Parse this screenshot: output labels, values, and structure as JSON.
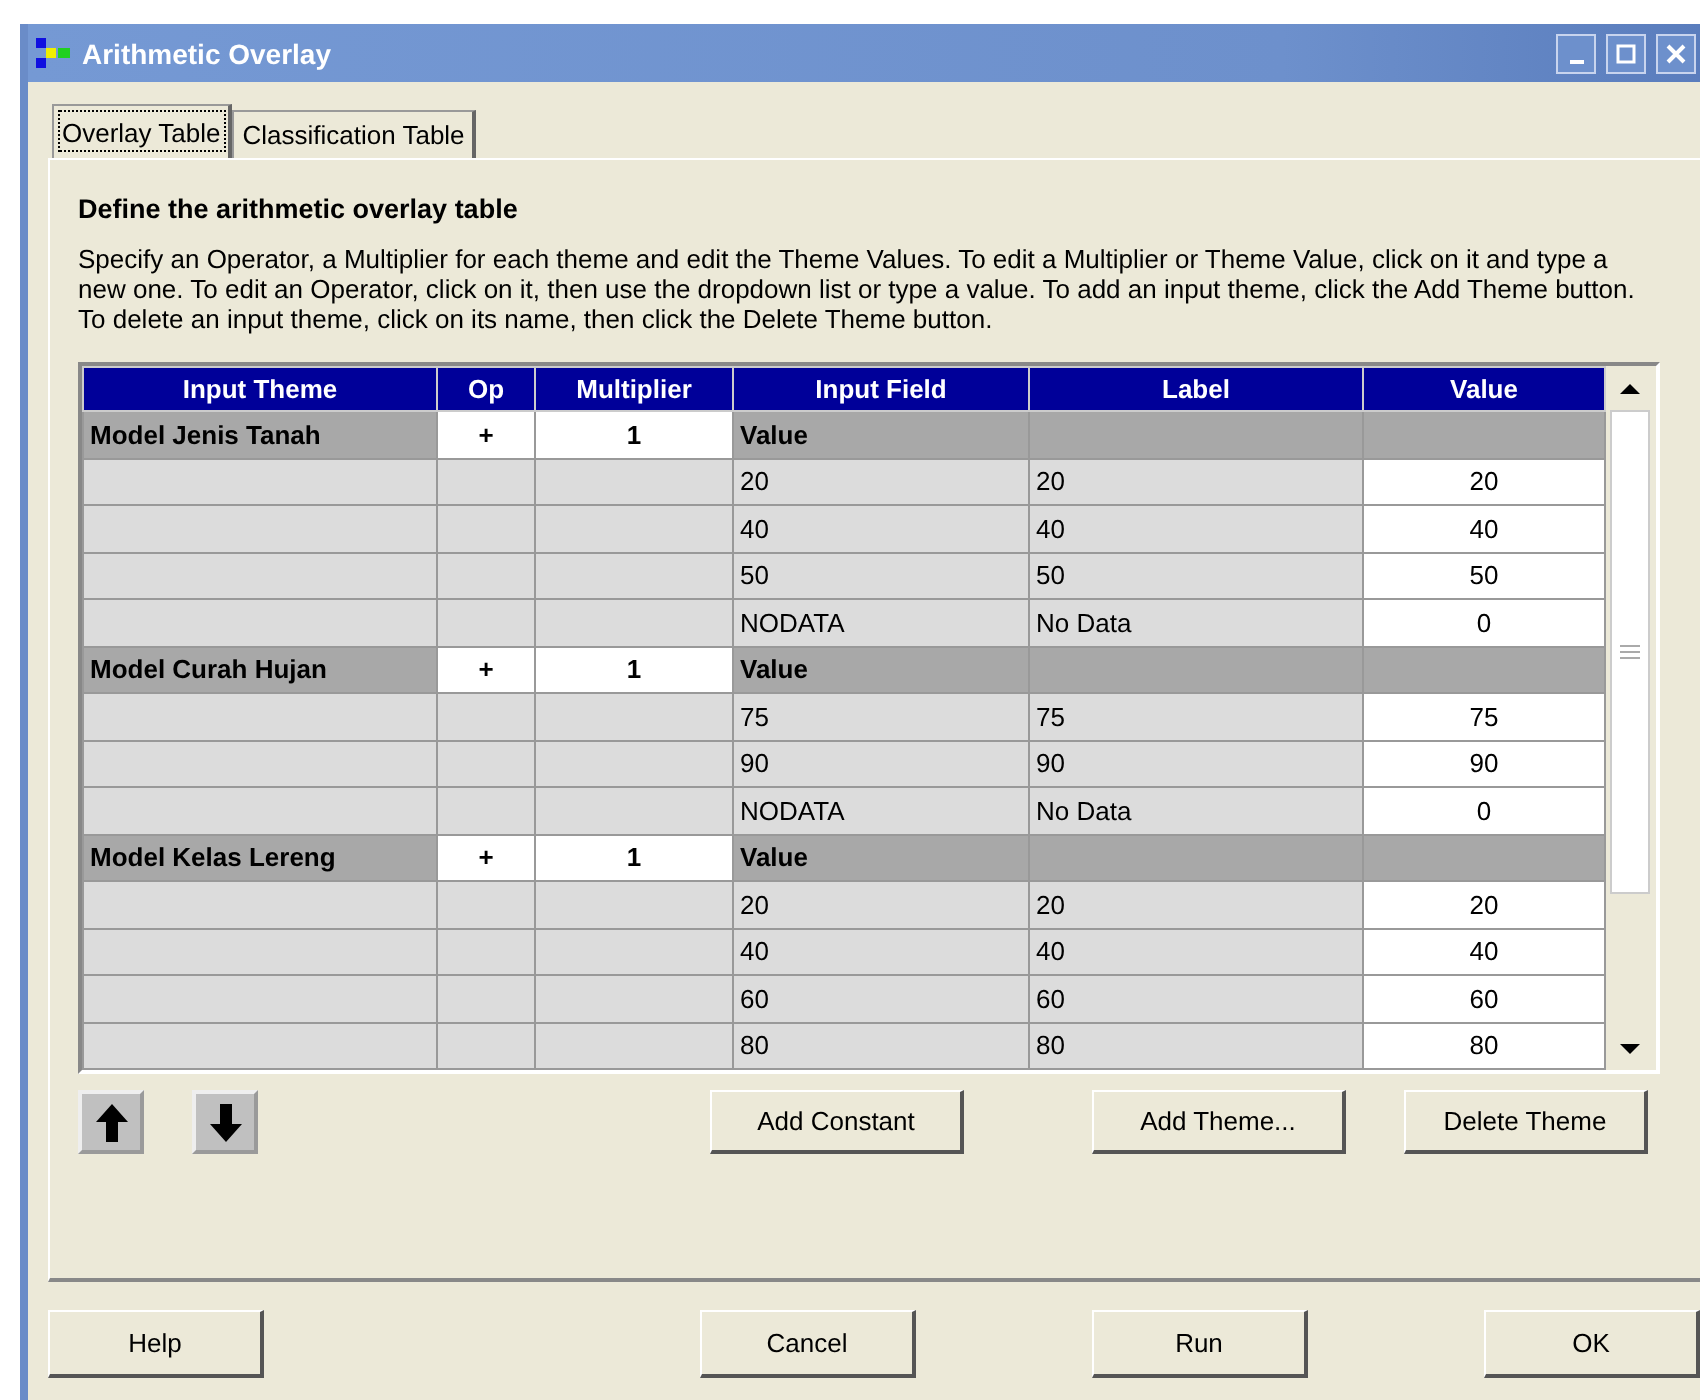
{
  "window": {
    "title": "Arithmetic Overlay"
  },
  "tabs": [
    {
      "label": "Overlay Table",
      "selected": true
    },
    {
      "label": "Classification Table",
      "selected": false
    }
  ],
  "heading": "Define the arithmetic overlay table",
  "description": "Specify an Operator, a Multiplier for each theme and edit the Theme Values. To edit a Multiplier or Theme Value, click on it and type a new one. To edit an Operator, click on it, then use the dropdown list or type a value. To add an input theme, click the Add Theme button. To delete an input theme, click on its name, then click the Delete Theme button.",
  "table": {
    "columns": [
      "Input Theme",
      "Op",
      "Multiplier",
      "Input Field",
      "Label",
      "Value"
    ],
    "rows": [
      {
        "kind": "theme",
        "theme": "Model Jenis Tanah",
        "op": "+",
        "multiplier": "1",
        "field": "Value"
      },
      {
        "kind": "value",
        "field": "20",
        "label": "20",
        "value": "20"
      },
      {
        "kind": "value",
        "field": "40",
        "label": "40",
        "value": "40"
      },
      {
        "kind": "value",
        "field": "50",
        "label": "50",
        "value": "50"
      },
      {
        "kind": "value",
        "field": "NODATA",
        "label": "No Data",
        "value": "0"
      },
      {
        "kind": "theme",
        "theme": "Model Curah Hujan",
        "op": "+",
        "multiplier": "1",
        "field": "Value"
      },
      {
        "kind": "value",
        "field": "75",
        "label": "75",
        "value": "75"
      },
      {
        "kind": "value",
        "field": "90",
        "label": "90",
        "value": "90"
      },
      {
        "kind": "value",
        "field": "NODATA",
        "label": "No Data",
        "value": "0"
      },
      {
        "kind": "theme",
        "theme": "Model Kelas Lereng",
        "op": "+",
        "multiplier": "1",
        "field": "Value"
      },
      {
        "kind": "value",
        "field": "20",
        "label": "20",
        "value": "20"
      },
      {
        "kind": "value",
        "field": "40",
        "label": "40",
        "value": "40"
      },
      {
        "kind": "value",
        "field": "60",
        "label": "60",
        "value": "60"
      },
      {
        "kind": "value",
        "field": "80",
        "label": "80",
        "value": "80"
      }
    ]
  },
  "table_buttons": [
    "Add Constant",
    "Add Theme...",
    "Delete Theme"
  ],
  "dialog_buttons": [
    "Help",
    "Cancel",
    "Run",
    "OK"
  ]
}
